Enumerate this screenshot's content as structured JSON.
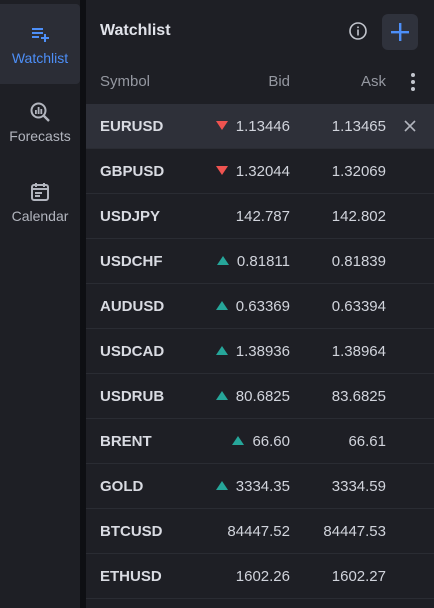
{
  "sidebar": {
    "items": [
      {
        "label": "Watchlist",
        "icon": "watchlist-icon",
        "active": true
      },
      {
        "label": "Forecasts",
        "icon": "forecasts-icon",
        "active": false
      },
      {
        "label": "Calendar",
        "icon": "calendar-icon",
        "active": false
      }
    ]
  },
  "header": {
    "title": "Watchlist",
    "info_icon": "info-icon",
    "add_icon": "plus-icon"
  },
  "columns": {
    "symbol": "Symbol",
    "bid": "Bid",
    "ask": "Ask",
    "more_icon": "more-vertical-icon"
  },
  "colors": {
    "up": "#26a69a",
    "down": "#ef5350",
    "accent": "#4d8ff8"
  },
  "rows": [
    {
      "symbol": "EURUSD",
      "bid": "1.13446",
      "ask": "1.13465",
      "trend": "down",
      "selected": true
    },
    {
      "symbol": "GBPUSD",
      "bid": "1.32044",
      "ask": "1.32069",
      "trend": "down",
      "selected": false
    },
    {
      "symbol": "USDJPY",
      "bid": "142.787",
      "ask": "142.802",
      "trend": "none",
      "selected": false
    },
    {
      "symbol": "USDCHF",
      "bid": "0.81811",
      "ask": "0.81839",
      "trend": "up",
      "selected": false
    },
    {
      "symbol": "AUDUSD",
      "bid": "0.63369",
      "ask": "0.63394",
      "trend": "up",
      "selected": false
    },
    {
      "symbol": "USDCAD",
      "bid": "1.38936",
      "ask": "1.38964",
      "trend": "up",
      "selected": false
    },
    {
      "symbol": "USDRUB",
      "bid": "80.6825",
      "ask": "83.6825",
      "trend": "up",
      "selected": false
    },
    {
      "symbol": "BRENT",
      "bid": "66.60",
      "ask": "66.61",
      "trend": "up",
      "selected": false
    },
    {
      "symbol": "GOLD",
      "bid": "3334.35",
      "ask": "3334.59",
      "trend": "up",
      "selected": false
    },
    {
      "symbol": "BTCUSD",
      "bid": "84447.52",
      "ask": "84447.53",
      "trend": "none",
      "selected": false
    },
    {
      "symbol": "ETHUSD",
      "bid": "1602.26",
      "ask": "1602.27",
      "trend": "none",
      "selected": false
    }
  ]
}
